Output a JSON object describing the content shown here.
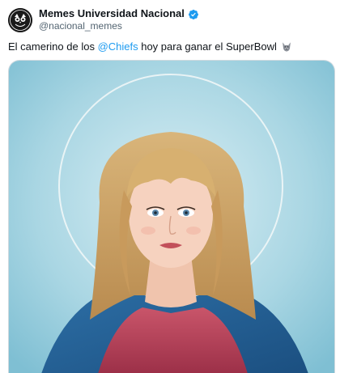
{
  "tweet": {
    "author": {
      "display_name": "Memes Universidad Nacional",
      "handle": "@nacional_memes",
      "verified": true,
      "avatar_icon": "owl-logo-icon"
    },
    "text": {
      "before": "El camerino de los ",
      "mention": "@Chiefs",
      "after": " hoy para ganar el SuperBowl",
      "emoji": "wolf-face-icon"
    },
    "media": {
      "kind": "illustration",
      "subject": "portrait-with-halo"
    }
  },
  "colors": {
    "link": "#1d9bf0",
    "verified": "#1d9bf0",
    "text": "#0f1419",
    "secondary": "#536471"
  }
}
